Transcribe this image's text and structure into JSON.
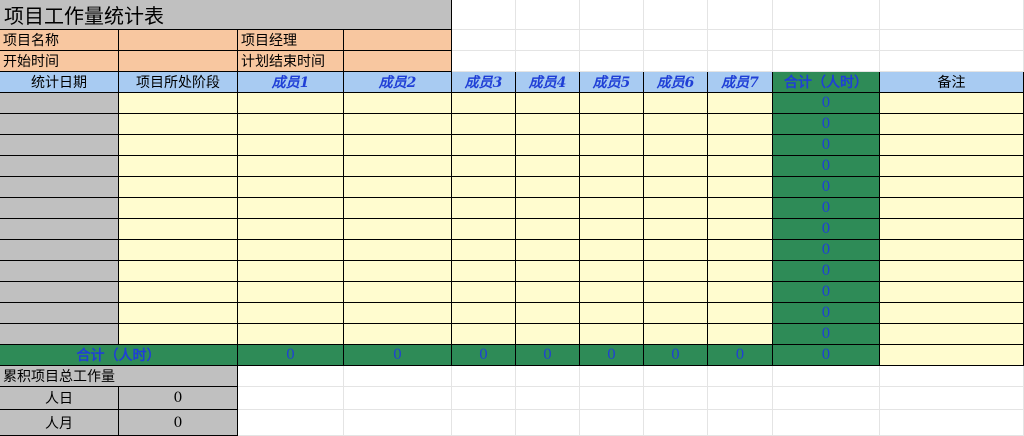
{
  "title": "项目工作量统计表",
  "info": {
    "project_name_label": "项目名称",
    "project_manager_label": "项目经理",
    "start_time_label": "开始时间",
    "planned_end_time_label": "计划结束时间"
  },
  "headers": {
    "date": "统计日期",
    "stage": "项目所处阶段",
    "members": [
      "成员1",
      "成员2",
      "成员3",
      "成员4",
      "成员5",
      "成员6",
      "成员7"
    ],
    "total": "合计（人时）",
    "remark": "备注"
  },
  "row_totals": [
    "0",
    "0",
    "0",
    "0",
    "0",
    "0",
    "0",
    "0",
    "0",
    "0",
    "0",
    "0"
  ],
  "summary": {
    "label": "合计（人时）",
    "member_totals": [
      "0",
      "0",
      "0",
      "0",
      "0",
      "0",
      "0"
    ],
    "grand_total": "0"
  },
  "cumulative": {
    "label": "累积项目总工作量",
    "person_day_label": "人日",
    "person_day_value": "0",
    "person_month_label": "人月",
    "person_month_value": "0"
  },
  "colors": {
    "gray": "#c0c0c0",
    "orange": "#f8c7a0",
    "header_blue": "#a8cbf2",
    "input_yellow": "#fffccf",
    "total_green": "#2e8b57",
    "value_blue": "#1f3fd6"
  }
}
